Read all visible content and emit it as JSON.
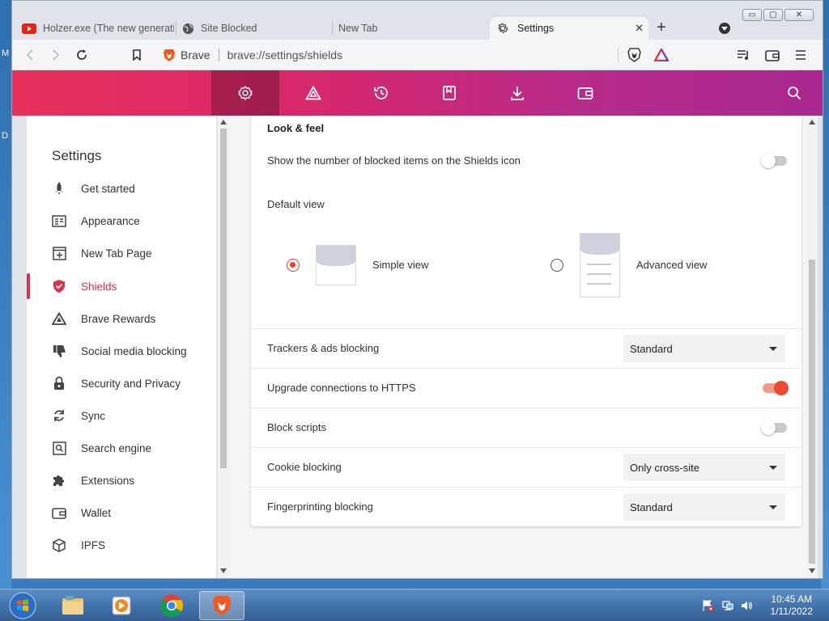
{
  "desktop": {
    "letters": [
      "M",
      "D"
    ]
  },
  "window": {
    "controls": {
      "minimize": "▭",
      "maximize": "▢",
      "close": "✕"
    }
  },
  "tabs": [
    {
      "label": "Holzer.exe (The new generatio",
      "icon": "youtube-icon"
    },
    {
      "label": "Site Blocked",
      "icon": "globe-icon"
    },
    {
      "label": "New Tab",
      "icon": ""
    },
    {
      "label": "Settings",
      "icon": "gear-icon",
      "active": true,
      "close": "✕"
    }
  ],
  "new_tab": "+",
  "toolbar": {
    "brand": "Brave",
    "url": "brave://settings/shields"
  },
  "header": {
    "icons": [
      "gear-icon",
      "rewards-triangle-icon",
      "history-icon",
      "bookmarks-icon",
      "downloads-icon",
      "wallet-icon"
    ],
    "search_icon": "search-icon"
  },
  "sidebar": {
    "title": "Settings",
    "items": [
      {
        "label": "Get started",
        "icon": "rocket-icon"
      },
      {
        "label": "Appearance",
        "icon": "appearance-icon"
      },
      {
        "label": "New Tab Page",
        "icon": "new-tab-page-icon"
      },
      {
        "label": "Shields",
        "icon": "shield-icon",
        "active": true
      },
      {
        "label": "Brave Rewards",
        "icon": "rewards-triangle-icon"
      },
      {
        "label": "Social media blocking",
        "icon": "thumbs-down-icon"
      },
      {
        "label": "Security and Privacy",
        "icon": "lock-icon"
      },
      {
        "label": "Sync",
        "icon": "sync-icon"
      },
      {
        "label": "Search engine",
        "icon": "search-engine-icon"
      },
      {
        "label": "Extensions",
        "icon": "puzzle-icon"
      },
      {
        "label": "Wallet",
        "icon": "wallet-icon"
      },
      {
        "label": "IPFS",
        "icon": "cube-icon"
      }
    ]
  },
  "main": {
    "section_title": "Look & feel",
    "show_count_label": "Show the number of blocked items on the Shields icon",
    "show_count_on": false,
    "default_view_label": "Default view",
    "simple_view_label": "Simple view",
    "advanced_view_label": "Advanced view",
    "selected_view": "simple",
    "trackers_label": "Trackers & ads blocking",
    "trackers_value": "Standard",
    "https_label": "Upgrade connections to HTTPS",
    "https_on": true,
    "scripts_label": "Block scripts",
    "scripts_on": false,
    "cookie_label": "Cookie blocking",
    "cookie_value": "Only cross-site",
    "fingerprint_label": "Fingerprinting blocking",
    "fingerprint_value": "Standard"
  },
  "taskbar": {
    "time": "10:45 AM",
    "date": "1/11/2022",
    "apps": [
      "start-orb-icon",
      "explorer-icon",
      "media-player-icon",
      "chrome-icon",
      "brave-icon"
    ]
  },
  "colors": {
    "accent": "#e8412b",
    "header_start": "#e8305a",
    "header_end": "#a9288f",
    "nav_active": "#d9334b"
  }
}
